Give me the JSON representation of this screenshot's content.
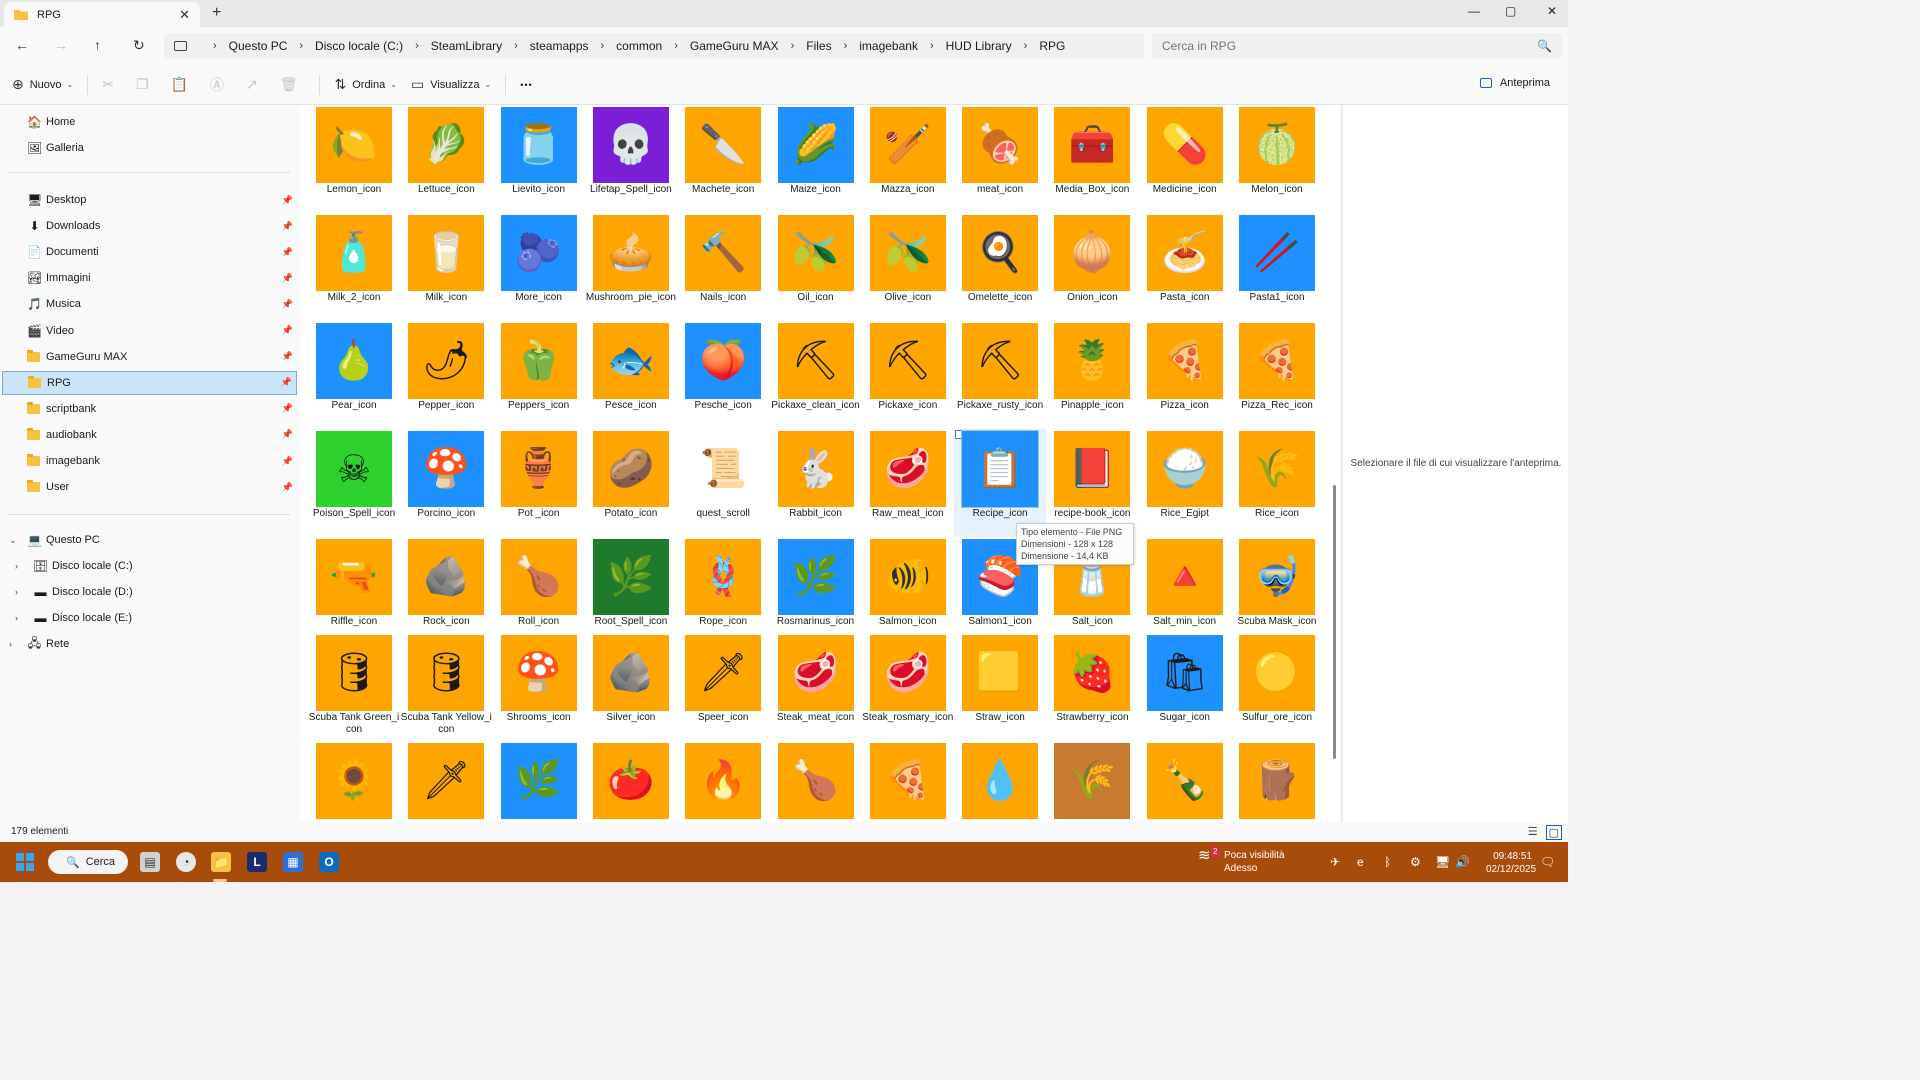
{
  "window": {
    "tab_title": "RPG",
    "new_tab": "+",
    "close_tab": "✕",
    "controls": {
      "minimize": "—",
      "maximize": "▢",
      "close": "✕"
    }
  },
  "nav": {
    "back": "←",
    "forward": "→",
    "up": "↑",
    "refresh": "↻"
  },
  "breadcrumb": [
    "Questo PC",
    "Disco locale (C:)",
    "SteamLibrary",
    "steamapps",
    "common",
    "GameGuru MAX",
    "Files",
    "imagebank",
    "HUD Library",
    "RPG"
  ],
  "search": {
    "placeholder": "Cerca in RPG",
    "icon": "🔍"
  },
  "commandbar": {
    "new_label": "Nuovo",
    "sort_label": "Ordina",
    "view_label": "Visualizza",
    "more": "•••",
    "preview_label": "Anteprima"
  },
  "sidebar": {
    "quick": [
      {
        "label": "Home",
        "icon": "🏠"
      },
      {
        "label": "Galleria",
        "icon": "🖼"
      }
    ],
    "pinned": [
      {
        "label": "Desktop",
        "icon": "🖥"
      },
      {
        "label": "Downloads",
        "icon": "⬇"
      },
      {
        "label": "Documenti",
        "icon": "📄"
      },
      {
        "label": "Immagini",
        "icon": "🏞"
      },
      {
        "label": "Musica",
        "icon": "🎵"
      },
      {
        "label": "Video",
        "icon": "🎬"
      },
      {
        "label": "GameGuru MAX",
        "icon": "folder"
      },
      {
        "label": "RPG",
        "icon": "folder"
      },
      {
        "label": "scriptbank",
        "icon": "folder"
      },
      {
        "label": "audiobank",
        "icon": "folder"
      },
      {
        "label": "imagebank",
        "icon": "folder"
      },
      {
        "label": "User",
        "icon": "folder"
      }
    ],
    "pin_glyph": "📌",
    "tree": [
      {
        "label": "Questo PC",
        "icon": "💻",
        "chevron": "⌄"
      },
      {
        "label": "Disco locale (C:)",
        "icon": "🗄",
        "chevron": "›"
      },
      {
        "label": "Disco locale (D:)",
        "icon": "▬",
        "chevron": "›"
      },
      {
        "label": "Disco locale (E:)",
        "icon": "▬",
        "chevron": "›"
      },
      {
        "label": "Rete",
        "icon": "🖧",
        "chevron": "›"
      }
    ]
  },
  "files": [
    {
      "name": "Lemon_icon",
      "bg": "#ffa500",
      "glyph": "🍋"
    },
    {
      "name": "Lettuce_icon",
      "bg": "#ffa500",
      "glyph": "🥬"
    },
    {
      "name": "Lievito_icon",
      "bg": "#1e90ff",
      "glyph": "🫙"
    },
    {
      "name": "Lifetap_Spell_icon",
      "bg": "#7b1fd6",
      "glyph": "💀"
    },
    {
      "name": "Machete_icon",
      "bg": "#ffa500",
      "glyph": "🔪"
    },
    {
      "name": "Maize_icon",
      "bg": "#1e90ff",
      "glyph": "🌽"
    },
    {
      "name": "Mazza_icon",
      "bg": "#ffa500",
      "glyph": "🏏"
    },
    {
      "name": "meat_icon",
      "bg": "#ffa500",
      "glyph": "🍖"
    },
    {
      "name": "Media_Box_icon",
      "bg": "#ffa500",
      "glyph": "🧰"
    },
    {
      "name": "Medicine_icon",
      "bg": "#ffa500",
      "glyph": "💊"
    },
    {
      "name": "Melon_icon",
      "bg": "#ffa500",
      "glyph": "🍈"
    },
    {
      "name": "Milk_2_icon",
      "bg": "#ffa500",
      "glyph": "🧴"
    },
    {
      "name": "Milk_icon",
      "bg": "#ffa500",
      "glyph": "🥛"
    },
    {
      "name": "More_icon",
      "bg": "#1e90ff",
      "glyph": "🫐"
    },
    {
      "name": "Mushroom_pie_icon",
      "bg": "#ffa500",
      "glyph": "🥧"
    },
    {
      "name": "Nails_icon",
      "bg": "#ffa500",
      "glyph": "🔨"
    },
    {
      "name": "Oil_icon",
      "bg": "#ffa500",
      "glyph": "🫒"
    },
    {
      "name": "Olive_icon",
      "bg": "#ffa500",
      "glyph": "🫒"
    },
    {
      "name": "Omelette_icon",
      "bg": "#ffa500",
      "glyph": "🍳"
    },
    {
      "name": "Onion_icon",
      "bg": "#ffa500",
      "glyph": "🧅"
    },
    {
      "name": "Pasta_icon",
      "bg": "#ffa500",
      "glyph": "🍝"
    },
    {
      "name": "Pasta1_icon",
      "bg": "#1e90ff",
      "glyph": "🥢"
    },
    {
      "name": "Pear_icon",
      "bg": "#1e90ff",
      "glyph": "🍐"
    },
    {
      "name": "Pepper_icon",
      "bg": "#ffa500",
      "glyph": "🌶"
    },
    {
      "name": "Peppers_icon",
      "bg": "#ffa500",
      "glyph": "🫑"
    },
    {
      "name": "Pesce_icon",
      "bg": "#ffa500",
      "glyph": "🐟"
    },
    {
      "name": "Pesche_icon",
      "bg": "#1e90ff",
      "glyph": "🍑"
    },
    {
      "name": "Pickaxe_clean_icon",
      "bg": "#ffa500",
      "glyph": "⛏"
    },
    {
      "name": "Pickaxe_icon",
      "bg": "#ffa500",
      "glyph": "⛏"
    },
    {
      "name": "Pickaxe_rusty_icon",
      "bg": "#ffa500",
      "glyph": "⛏"
    },
    {
      "name": "Pinapple_icon",
      "bg": "#ffa500",
      "glyph": "🍍"
    },
    {
      "name": "Pizza_icon",
      "bg": "#ffa500",
      "glyph": "🍕"
    },
    {
      "name": "Pizza_Rec_icon",
      "bg": "#ffa500",
      "glyph": "🍕"
    },
    {
      "name": "Poison_Spell_icon",
      "bg": "#2fd12f",
      "glyph": "☠"
    },
    {
      "name": "Porcino_icon",
      "bg": "#1e90ff",
      "glyph": "🍄"
    },
    {
      "name": "Pot _icon",
      "bg": "#ffa500",
      "glyph": "🏺"
    },
    {
      "name": "Potato_icon",
      "bg": "#ffa500",
      "glyph": "🥔"
    },
    {
      "name": "quest_scroll",
      "bg": "#ffffff",
      "glyph": "📜"
    },
    {
      "name": "Rabbit_icon",
      "bg": "#ffa500",
      "glyph": "🐇"
    },
    {
      "name": "Raw_meat_icon",
      "bg": "#ffa500",
      "glyph": "🥩"
    },
    {
      "name": "Recipe_icon",
      "bg": "#1e90ff",
      "glyph": "📋"
    },
    {
      "name": "recipe-book_icon",
      "bg": "#ffa500",
      "glyph": "📕"
    },
    {
      "name": "Rice_Egipt",
      "bg": "#ffa500",
      "glyph": "🍚"
    },
    {
      "name": "Rice_icon",
      "bg": "#ffa500",
      "glyph": "🌾"
    },
    {
      "name": "Riffle_icon",
      "bg": "#ffa500",
      "glyph": "🔫"
    },
    {
      "name": "Rock_icon",
      "bg": "#ffa500",
      "glyph": "🪨"
    },
    {
      "name": "Roll_icon",
      "bg": "#ffa500",
      "glyph": "🍗"
    },
    {
      "name": "Root_Spell_icon",
      "bg": "#1f7a2e",
      "glyph": "🌿"
    },
    {
      "name": "Rope_icon",
      "bg": "#ffa500",
      "glyph": "🪢"
    },
    {
      "name": "Rosmarinus_icon",
      "bg": "#1e90ff",
      "glyph": "🌿"
    },
    {
      "name": "Salmon_icon",
      "bg": "#ffa500",
      "glyph": "🐠"
    },
    {
      "name": "Salmon1_icon",
      "bg": "#1e90ff",
      "glyph": "🍣"
    },
    {
      "name": "Salt_icon",
      "bg": "#ffa500",
      "glyph": "🧂"
    },
    {
      "name": "Salt_min_icon",
      "bg": "#ffa500",
      "glyph": "🔺"
    },
    {
      "name": "Scuba Mask_icon",
      "bg": "#ffa500",
      "glyph": "🤿"
    },
    {
      "name": "Scuba Tank Green_icon",
      "bg": "#ffa500",
      "glyph": "🛢"
    },
    {
      "name": "Scuba Tank Yellow_icon",
      "bg": "#ffa500",
      "glyph": "🛢"
    },
    {
      "name": "Shrooms_icon",
      "bg": "#ffa500",
      "glyph": "🍄"
    },
    {
      "name": "Silver_icon",
      "bg": "#ffa500",
      "glyph": "🪨"
    },
    {
      "name": "Speer_icon",
      "bg": "#ffa500",
      "glyph": "🗡"
    },
    {
      "name": "Steak_meat_icon",
      "bg": "#ffa500",
      "glyph": "🥩"
    },
    {
      "name": "Steak_rosmary_icon",
      "bg": "#ffa500",
      "glyph": "🥩"
    },
    {
      "name": "Straw_icon",
      "bg": "#ffa500",
      "glyph": "🟨"
    },
    {
      "name": "Strawberry_icon",
      "bg": "#ffa500",
      "glyph": "🍓"
    },
    {
      "name": "Sugar_icon",
      "bg": "#1e90ff",
      "glyph": "🛍"
    },
    {
      "name": "Sulfur_ore_icon",
      "bg": "#ffa500",
      "glyph": "🟡"
    },
    {
      "name": "",
      "bg": "#ffa500",
      "glyph": "🌻"
    },
    {
      "name": "",
      "bg": "#ffa500",
      "glyph": "🗡"
    },
    {
      "name": "",
      "bg": "#1e90ff",
      "glyph": "🌿"
    },
    {
      "name": "",
      "bg": "#ffa500",
      "glyph": "🍅"
    },
    {
      "name": "",
      "bg": "#ffa500",
      "glyph": "🔥"
    },
    {
      "name": "",
      "bg": "#ffa500",
      "glyph": "🍗"
    },
    {
      "name": "",
      "bg": "#ffa500",
      "glyph": "🍕"
    },
    {
      "name": "",
      "bg": "#ffa500",
      "glyph": "💧"
    },
    {
      "name": "",
      "bg": "#c87a30",
      "glyph": "🌾"
    },
    {
      "name": "",
      "bg": "#ffa500",
      "glyph": "🍾"
    },
    {
      "name": "",
      "bg": "#ffa500",
      "glyph": "🪵"
    }
  ],
  "tooltip": {
    "line1": "Tipo elemento - File PNG",
    "line2": "Dimensioni - 128 x 128",
    "line3": "Dimensione - 14,4 KB"
  },
  "preview_message": "Selezionare il file di cui visualizzare l'anteprima.",
  "status": {
    "count": "179 elementi"
  },
  "taskbar": {
    "search_label": "Cerca",
    "weather_text": "Poca visibilità",
    "weather_sub": "Adesso",
    "weather_badge": "2",
    "time": "09:48:51",
    "date": "02/12/2025"
  },
  "colors": {
    "accent": "#1a5fb4",
    "selection": "#cce4f7",
    "taskbar": "#a84c0c"
  }
}
